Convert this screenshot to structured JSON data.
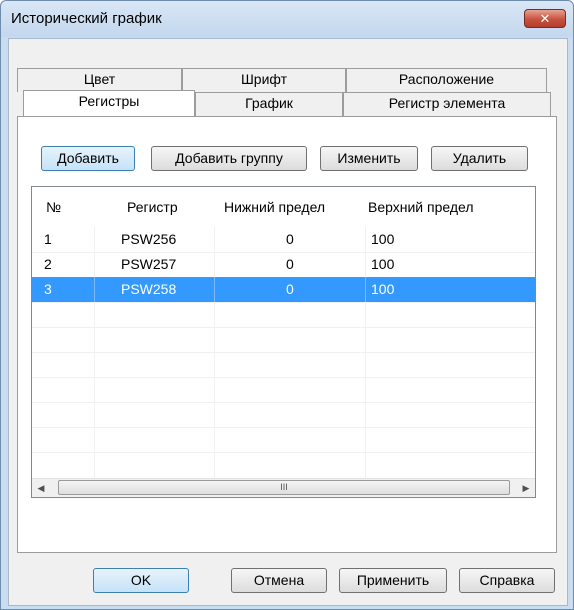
{
  "window": {
    "title": "Исторический график",
    "close_glyph": "✕"
  },
  "tabs": {
    "back_row": [
      {
        "label": "Цвет"
      },
      {
        "label": "Шрифт"
      },
      {
        "label": "Расположение"
      }
    ],
    "front_row": [
      {
        "label": "Регистры",
        "active": true
      },
      {
        "label": "График"
      },
      {
        "label": "Регистр элемента"
      }
    ]
  },
  "toolbar": {
    "add_label": "Добавить",
    "add_group_label": "Добавить группу",
    "edit_label": "Изменить",
    "delete_label": "Удалить"
  },
  "table": {
    "columns": [
      "№",
      "Регистр",
      "Нижний предел",
      "Верхний предел"
    ],
    "rows": [
      {
        "num": "1",
        "register": "PSW256",
        "low": "0",
        "high": "100",
        "selected": false
      },
      {
        "num": "2",
        "register": "PSW257",
        "low": "0",
        "high": "100",
        "selected": false
      },
      {
        "num": "3",
        "register": "PSW258",
        "low": "0",
        "high": "100",
        "selected": true
      }
    ],
    "scroll_left_glyph": "◀",
    "scroll_right_glyph": "▶",
    "scroll_grip_glyph": "III"
  },
  "footer": {
    "ok_label": "OK",
    "cancel_label": "Отмена",
    "apply_label": "Применить",
    "help_label": "Справка"
  }
}
